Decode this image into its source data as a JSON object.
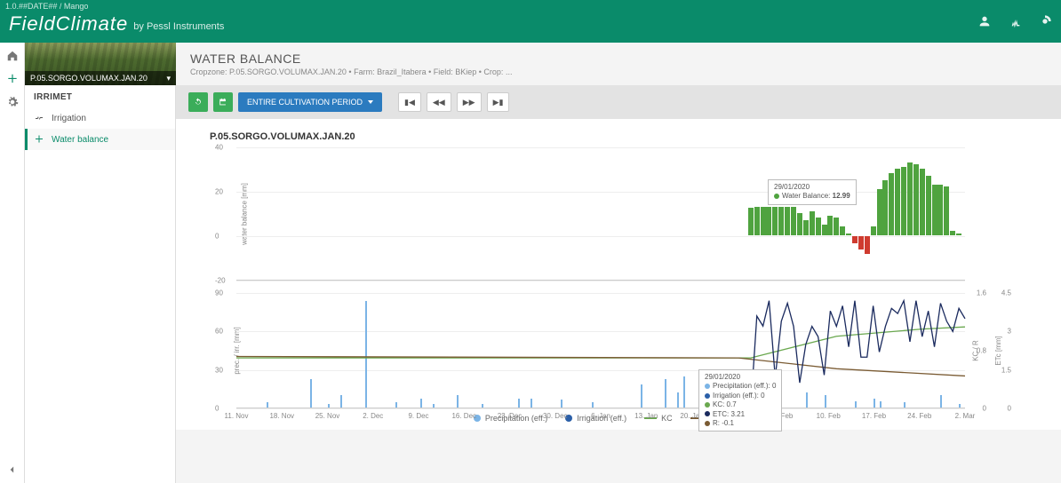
{
  "header": {
    "version": "1.0.##DATE## / Mango",
    "brand": "FieldClimate",
    "by": "by Pessl Instruments"
  },
  "sidebar": {
    "cropzone_label": "P.05.SORGO.VOLUMAX.JAN.20",
    "section": "IRRIMET",
    "items": [
      {
        "label": "Irrigation"
      },
      {
        "label": "Water balance"
      }
    ]
  },
  "page": {
    "title": "WATER BALANCE",
    "sub_prefix": "Cropzone: ",
    "sub_cz": "P.05.SORGO.VOLUMAX.JAN.20",
    "sub_farm": " • Farm: Brazil_Itabera • Field: BKiep • Crop: ..."
  },
  "toolbar": {
    "period_label": "ENTIRE CULTIVATION PERIOD"
  },
  "tooltip_wb": {
    "date": "29/01/2020",
    "label": "Water Balance:",
    "value": "12.99"
  },
  "tooltip_lower": {
    "date": "29/01/2020",
    "precip": "Precipitation (eff.): 0",
    "irr": "Irrigation (eff.): 0",
    "kc": "KC: 0.7",
    "etc": "ETC: 3.21",
    "r": "R: -0.1"
  },
  "legend": {
    "precip": "Precipitation (eff.)",
    "irr": "Irrigation (eff.)",
    "kc": "KC",
    "etc": "ETC",
    "r": "R"
  },
  "chart_data": [
    {
      "type": "bar",
      "title": "P.05.SORGO.VOLUMAX.JAN.20",
      "ylabel": "water balance [mm]",
      "ylim": [
        -20,
        40
      ],
      "yticks": [
        -20,
        0,
        20,
        40
      ],
      "x_start": "2019-11-04",
      "x_end": "2020-03-02",
      "series": [
        {
          "name": "Water Balance",
          "color": "#4fa33f",
          "points": [
            {
              "x": "2020-01-27",
              "y": 12.5
            },
            {
              "x": "2020-01-28",
              "y": 13
            },
            {
              "x": "2020-01-29",
              "y": 12.99
            },
            {
              "x": "2020-01-30",
              "y": 13
            },
            {
              "x": "2020-01-31",
              "y": 13
            },
            {
              "x": "2020-02-01",
              "y": 13
            },
            {
              "x": "2020-02-02",
              "y": 13
            },
            {
              "x": "2020-02-03",
              "y": 13
            },
            {
              "x": "2020-02-04",
              "y": 10
            },
            {
              "x": "2020-02-05",
              "y": 7
            },
            {
              "x": "2020-02-06",
              "y": 11
            },
            {
              "x": "2020-02-07",
              "y": 8
            },
            {
              "x": "2020-02-08",
              "y": 5
            },
            {
              "x": "2020-02-09",
              "y": 9
            },
            {
              "x": "2020-02-10",
              "y": 8
            },
            {
              "x": "2020-02-11",
              "y": 4
            },
            {
              "x": "2020-02-12",
              "y": 1
            },
            {
              "x": "2020-02-13",
              "y": -3
            },
            {
              "x": "2020-02-14",
              "y": -6
            },
            {
              "x": "2020-02-15",
              "y": -8
            },
            {
              "x": "2020-02-16",
              "y": 4
            },
            {
              "x": "2020-02-17",
              "y": 21
            },
            {
              "x": "2020-02-18",
              "y": 25
            },
            {
              "x": "2020-02-19",
              "y": 28
            },
            {
              "x": "2020-02-20",
              "y": 30
            },
            {
              "x": "2020-02-21",
              "y": 31
            },
            {
              "x": "2020-02-22",
              "y": 33
            },
            {
              "x": "2020-02-23",
              "y": 32
            },
            {
              "x": "2020-02-24",
              "y": 30
            },
            {
              "x": "2020-02-25",
              "y": 27
            },
            {
              "x": "2020-02-26",
              "y": 23
            },
            {
              "x": "2020-02-27",
              "y": 23
            },
            {
              "x": "2020-02-28",
              "y": 22
            },
            {
              "x": "2020-02-29",
              "y": 2
            },
            {
              "x": "2020-03-01",
              "y": 1
            }
          ]
        }
      ]
    },
    {
      "type": "mixed",
      "ylabel_left": "prec. / irr. [mm]",
      "ylabel_r1": "KC / R",
      "ylabel_r2": "ETc [mm]",
      "ylim_left": [
        0,
        90
      ],
      "yticks_left": [
        0,
        30,
        60,
        90
      ],
      "ylim_r1": [
        -0.0,
        1.6
      ],
      "yticks_r1": [
        -0.0,
        0.8,
        1.6
      ],
      "ylim_r2": [
        0,
        4.5
      ],
      "yticks_r2": [
        0,
        1.5,
        3,
        4.5
      ],
      "xticks": [
        "11. Nov",
        "18. Nov",
        "25. Nov",
        "2. Dec",
        "9. Dec",
        "16. Dec",
        "23. Dec",
        "30. Dec",
        "6. Jan",
        "13. Jan",
        "20. Jan",
        "27. Jan",
        "3. Feb",
        "10. Feb",
        "17. Feb",
        "24. Feb",
        "2. Mar"
      ],
      "series": [
        {
          "name": "Precipitation (eff.)",
          "type": "bar",
          "axis": "left",
          "color": "#7bb4e6",
          "points": [
            {
              "x": "2019-11-09",
              "y": 4
            },
            {
              "x": "2019-11-16",
              "y": 22
            },
            {
              "x": "2019-11-19",
              "y": 3
            },
            {
              "x": "2019-11-21",
              "y": 10
            },
            {
              "x": "2019-11-25",
              "y": 83
            },
            {
              "x": "2019-11-30",
              "y": 4
            },
            {
              "x": "2019-12-04",
              "y": 7
            },
            {
              "x": "2019-12-06",
              "y": 3
            },
            {
              "x": "2019-12-10",
              "y": 10
            },
            {
              "x": "2019-12-14",
              "y": 3
            },
            {
              "x": "2019-12-20",
              "y": 7
            },
            {
              "x": "2019-12-22",
              "y": 7
            },
            {
              "x": "2019-12-27",
              "y": 6
            },
            {
              "x": "2020-01-01",
              "y": 4
            },
            {
              "x": "2020-01-09",
              "y": 18
            },
            {
              "x": "2020-01-13",
              "y": 22
            },
            {
              "x": "2020-01-15",
              "y": 12
            },
            {
              "x": "2020-01-16",
              "y": 24
            },
            {
              "x": "2020-01-22",
              "y": 10
            },
            {
              "x": "2020-02-05",
              "y": 12
            },
            {
              "x": "2020-02-08",
              "y": 10
            },
            {
              "x": "2020-02-13",
              "y": 5
            },
            {
              "x": "2020-02-16",
              "y": 7
            },
            {
              "x": "2020-02-17",
              "y": 5
            },
            {
              "x": "2020-02-21",
              "y": 4
            },
            {
              "x": "2020-02-27",
              "y": 10
            },
            {
              "x": "2020-03-01",
              "y": 3
            }
          ]
        },
        {
          "name": "Irrigation (eff.)",
          "type": "bar",
          "axis": "left",
          "color": "#2b5fa8",
          "points": []
        },
        {
          "name": "KC",
          "type": "line",
          "axis": "r1",
          "color": "#6aa84f",
          "points": [
            {
              "x": "2019-11-04",
              "y": 0.7
            },
            {
              "x": "2020-01-27",
              "y": 0.7
            },
            {
              "x": "2020-02-10",
              "y": 1.0
            },
            {
              "x": "2020-02-24",
              "y": 1.1
            },
            {
              "x": "2020-03-02",
              "y": 1.13
            }
          ]
        },
        {
          "name": "ETC",
          "type": "line",
          "axis": "r2",
          "color": "#1a2a5e",
          "points": [
            {
              "x": "2020-01-27",
              "y": 0.0
            },
            {
              "x": "2020-01-28",
              "y": 3.6
            },
            {
              "x": "2020-01-29",
              "y": 3.21
            },
            {
              "x": "2020-01-30",
              "y": 4.2
            },
            {
              "x": "2020-01-31",
              "y": 1.2
            },
            {
              "x": "2020-02-01",
              "y": 3.4
            },
            {
              "x": "2020-02-02",
              "y": 4.1
            },
            {
              "x": "2020-02-03",
              "y": 3.2
            },
            {
              "x": "2020-02-04",
              "y": 1.0
            },
            {
              "x": "2020-02-05",
              "y": 2.5
            },
            {
              "x": "2020-02-06",
              "y": 3.2
            },
            {
              "x": "2020-02-07",
              "y": 2.8
            },
            {
              "x": "2020-02-08",
              "y": 1.3
            },
            {
              "x": "2020-02-09",
              "y": 3.8
            },
            {
              "x": "2020-02-10",
              "y": 3.2
            },
            {
              "x": "2020-02-11",
              "y": 4.0
            },
            {
              "x": "2020-02-12",
              "y": 2.4
            },
            {
              "x": "2020-02-13",
              "y": 4.2
            },
            {
              "x": "2020-02-14",
              "y": 2.0
            },
            {
              "x": "2020-02-15",
              "y": 2.0
            },
            {
              "x": "2020-02-16",
              "y": 4.0
            },
            {
              "x": "2020-02-17",
              "y": 2.2
            },
            {
              "x": "2020-02-18",
              "y": 3.2
            },
            {
              "x": "2020-02-19",
              "y": 3.9
            },
            {
              "x": "2020-02-20",
              "y": 3.7
            },
            {
              "x": "2020-02-21",
              "y": 4.2
            },
            {
              "x": "2020-02-22",
              "y": 2.6
            },
            {
              "x": "2020-02-23",
              "y": 4.2
            },
            {
              "x": "2020-02-24",
              "y": 2.8
            },
            {
              "x": "2020-02-25",
              "y": 3.8
            },
            {
              "x": "2020-02-26",
              "y": 2.4
            },
            {
              "x": "2020-02-27",
              "y": 4.1
            },
            {
              "x": "2020-02-28",
              "y": 3.4
            },
            {
              "x": "2020-02-29",
              "y": 3.0
            },
            {
              "x": "2020-03-01",
              "y": 3.9
            },
            {
              "x": "2020-03-02",
              "y": 3.5
            }
          ]
        },
        {
          "name": "R",
          "type": "line",
          "axis": "r1",
          "color": "#7a5b33",
          "points": [
            {
              "x": "2019-11-04",
              "y": 0.72
            },
            {
              "x": "2020-01-25",
              "y": 0.7
            },
            {
              "x": "2020-02-10",
              "y": 0.55
            },
            {
              "x": "2020-03-02",
              "y": 0.45
            }
          ]
        }
      ]
    }
  ]
}
